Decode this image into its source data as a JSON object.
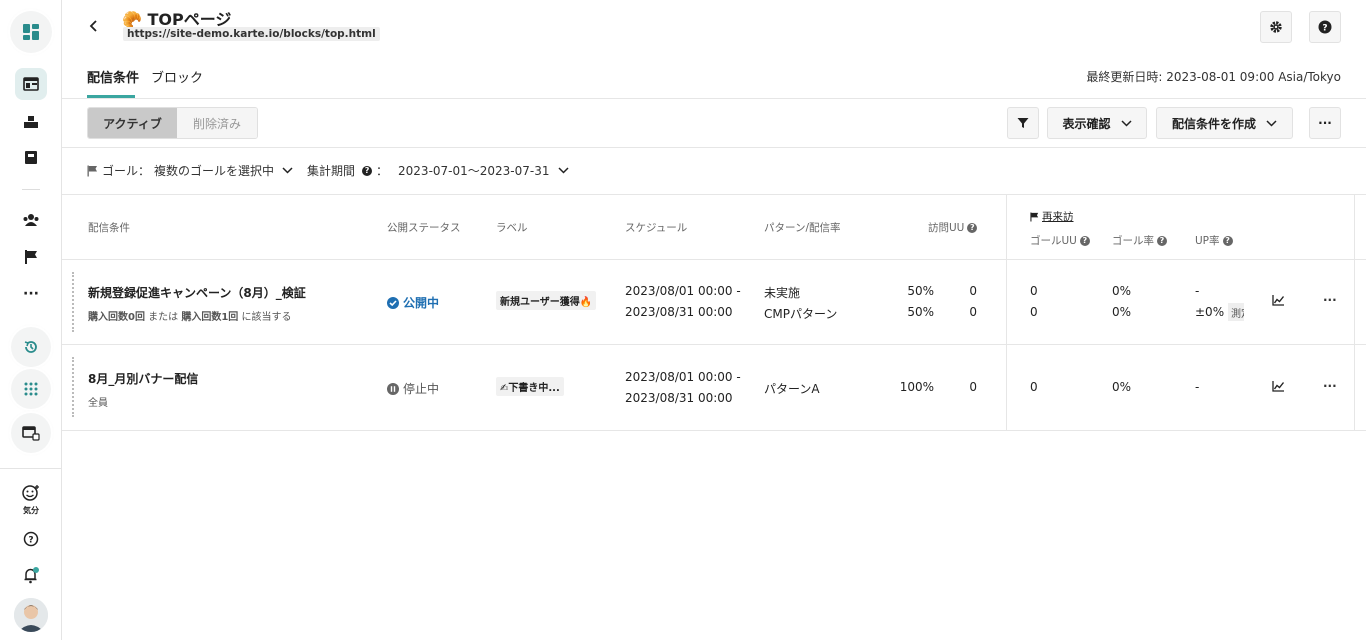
{
  "sidebar": {
    "items": [
      {
        "icon": "dashboard-icon"
      },
      {
        "icon": "layout-icon"
      },
      {
        "icon": "blocks-icon"
      },
      {
        "icon": "book-icon"
      },
      {
        "icon": "users-icon"
      },
      {
        "icon": "flag-icon"
      },
      {
        "icon": "more-icon"
      },
      {
        "icon": "history-icon"
      },
      {
        "icon": "grid-icon"
      },
      {
        "icon": "window-icon"
      }
    ],
    "mood_label": "気分"
  },
  "header": {
    "emoji": "🥐",
    "title": "TOPページ",
    "url": "https://site-demo.karte.io/blocks/top.html"
  },
  "tabs": [
    {
      "label": "配信条件",
      "active": true
    },
    {
      "label": "ブロック",
      "active": false
    }
  ],
  "last_updated": "最終更新日時: 2023-08-01 09:00 Asia/Tokyo",
  "toolbar": {
    "segment_active": "アクティブ",
    "segment_deleted": "削除済み",
    "preview_label": "表示確認",
    "create_label": "配信条件を作成"
  },
  "filters": {
    "goal_label": "ゴール：",
    "goal_value": "複数のゴールを選択中",
    "period_label": "集計期間",
    "period_colon": "：",
    "period_value": "2023-07-01〜2023-07-31"
  },
  "columns": {
    "condition": "配信条件",
    "status": "公開ステータス",
    "label": "ラベル",
    "schedule": "スケジュール",
    "pattern": "パターン/配信率",
    "visits": "訪問UU",
    "goal_group": "再来訪",
    "goal_uu": "ゴールUU",
    "goal_rate": "ゴール率",
    "up_rate": "UP率"
  },
  "rows": [
    {
      "name": "新規登録促進キャンペーン（8月）_検証",
      "cond_prefix": "購入回数0回",
      "cond_or": "または",
      "cond_mid": "購入回数1回",
      "cond_suffix": "に該当する",
      "status": "公開中",
      "label": "新規ユーザー獲得🔥",
      "schedule_start": "2023/08/01 00:00 -",
      "schedule_end": "2023/08/31 00:00",
      "patterns": [
        {
          "name": "未実施",
          "rate": "50%",
          "visits": "0",
          "goal_uu": "0",
          "goal_rate": "0%",
          "up": "-"
        },
        {
          "name": "CMPパターン",
          "rate": "50%",
          "visits": "0",
          "goal_uu": "0",
          "goal_rate": "0%",
          "up": "±0%",
          "up_badge": "測定"
        }
      ]
    },
    {
      "name": "8月_月別バナー配信",
      "condition": "全員",
      "status": "停止中",
      "label": "✍下書き中...",
      "schedule_start": "2023/08/01 00:00 -",
      "schedule_end": "2023/08/31 00:00",
      "patterns": [
        {
          "name": "パターンA",
          "rate": "100%",
          "visits": "0",
          "goal_uu": "0",
          "goal_rate": "0%",
          "up": "-"
        }
      ]
    }
  ],
  "colors": {
    "accent": "#3aa6a0",
    "active_status": "#1f6fb2",
    "paused_status": "#666666"
  }
}
